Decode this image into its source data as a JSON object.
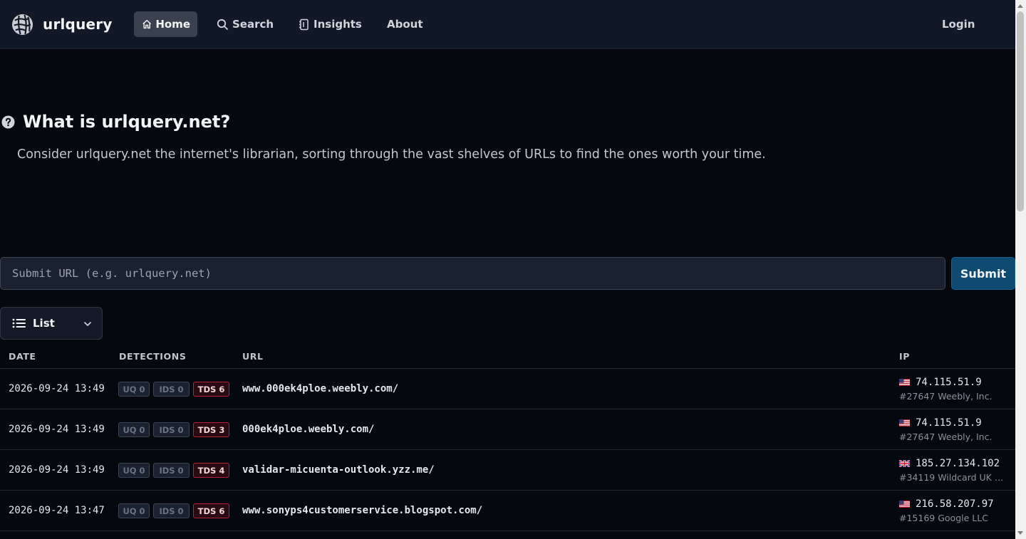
{
  "nav": {
    "brand": "urlquery",
    "items": [
      {
        "label": "Home",
        "icon": "home-icon",
        "active": true
      },
      {
        "label": "Search",
        "icon": "search-icon"
      },
      {
        "label": "Insights",
        "icon": "insights-icon"
      },
      {
        "label": "About"
      }
    ],
    "login": "Login"
  },
  "hero": {
    "title": "What is urlquery.net?",
    "description": "Consider urlquery.net the internet's librarian, sorting through the vast shelves of URLs to find the ones worth your time."
  },
  "submit": {
    "placeholder": "Submit URL (e.g. urlquery.net)",
    "value": "",
    "button_label": "Submit"
  },
  "view": {
    "selected": "List"
  },
  "table": {
    "columns": [
      "DATE",
      "DETECTIONS",
      "URL",
      "IP"
    ],
    "rows": [
      {
        "date": "2026-09-24 13:49",
        "uq": "UQ 0",
        "ids": "IDS 0",
        "tds": "TDS 6",
        "url": "www.000ek4ploe.weebly.com/",
        "flag": "us-flag",
        "ip": "74.115.51.9",
        "asn": "#27647 Weebly, Inc."
      },
      {
        "date": "2026-09-24 13:49",
        "uq": "UQ 0",
        "ids": "IDS 0",
        "tds": "TDS 3",
        "url": "000ek4ploe.weebly.com/",
        "flag": "us-flag",
        "ip": "74.115.51.9",
        "asn": "#27647 Weebly, Inc."
      },
      {
        "date": "2026-09-24 13:49",
        "uq": "UQ 0",
        "ids": "IDS 0",
        "tds": "TDS 4",
        "url": "validar-micuenta-outlook.yzz.me/",
        "flag": "uk-flag",
        "ip": "185.27.134.102",
        "asn": "#34119 Wildcard UK Li..."
      },
      {
        "date": "2026-09-24 13:47",
        "uq": "UQ 0",
        "ids": "IDS 0",
        "tds": "TDS 6",
        "url": "www.sonyps4customerservice.blogspot.com/",
        "flag": "us-flag",
        "ip": "216.58.207.97",
        "asn": "#15169 Google LLC"
      }
    ]
  },
  "colors": {
    "background": "#05080f",
    "navbar": "#111827",
    "submit_button": "#0f4a72",
    "tds_border": "#b4233a"
  }
}
